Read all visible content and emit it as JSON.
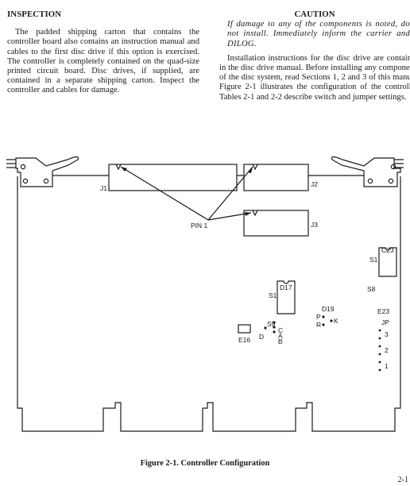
{
  "left_column": {
    "heading": "INSPECTION",
    "paragraph": "The padded shipping carton that contains the controller board also contains an instruction manual and cables to the first disc drive if this option is exercised. The controller is completely contained on the quad-size printed circuit board. Disc drives, if supplied, are contained in a separate shipping carton. Inspect the controller and cables for damage."
  },
  "right_column": {
    "caution_title": "CAUTION",
    "caution_text": "If damage to any of the components is noted, do not install. Immediately inform the carrier and DILOG.",
    "paragraph": "Installation instructions for the disc drive are contained in the disc drive manual. Before installing any components of the disc system, read Sections 1, 2 and 3 of this manual. Figure 2-1 illustrates the configuration of the controller. Tables 2-1 and 2-2 describe switch and jumper settings."
  },
  "figure": {
    "connectors": {
      "j1": "J1",
      "j2": "J2",
      "j3": "J3",
      "pin1": "PIN 1"
    },
    "switch_c23": {
      "name": "C23",
      "top": "S1",
      "bottom": "S8"
    },
    "switch_d17": {
      "name": "D17",
      "top": "S1",
      "bottom": "S9"
    },
    "e16": "E16",
    "d17_pins": {
      "c": "C",
      "a": "A",
      "b": "B",
      "d": "D"
    },
    "d19": {
      "name": "D19",
      "p": "P",
      "r": "R",
      "k": "K"
    },
    "e23": {
      "name": "E23",
      "jp": "JP",
      "pins": [
        "3",
        "2",
        "1"
      ]
    }
  },
  "caption": "Figure 2-1. Controller Configuration",
  "page_number": "2-1"
}
